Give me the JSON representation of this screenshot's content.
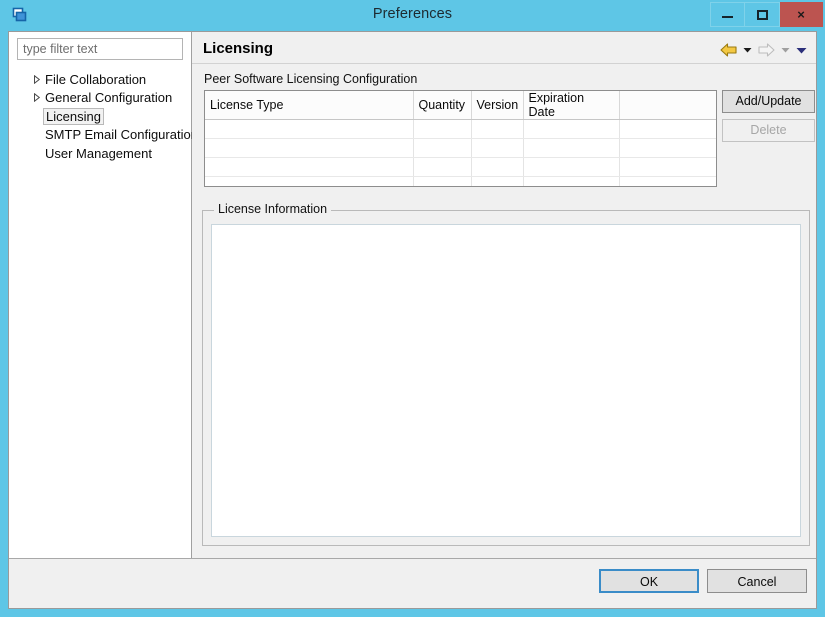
{
  "window": {
    "title": "Preferences",
    "icon": "preferences-window-icon",
    "titlebar_color": "#5ec6e6",
    "close_button_color": "#bc5450",
    "controls": {
      "minimize": "minimize-icon",
      "maximize": "maximize-icon",
      "close": "×"
    }
  },
  "sidebar": {
    "filter": {
      "value": "",
      "placeholder": "type filter text"
    },
    "tree": [
      {
        "label": "File Collaboration",
        "expandable": true,
        "selected": false
      },
      {
        "label": "General Configuration",
        "expandable": true,
        "selected": false
      },
      {
        "label": "Licensing",
        "expandable": false,
        "selected": true
      },
      {
        "label": "SMTP Email Configuration",
        "expandable": false,
        "selected": false
      },
      {
        "label": "User Management",
        "expandable": false,
        "selected": false
      }
    ]
  },
  "main": {
    "page_title": "Licensing",
    "section_label": "Peer Software Licensing Configuration",
    "toolbar": {
      "back": "back-arrow-icon",
      "back_menu": "back-dropdown-icon",
      "forward": "forward-arrow-icon",
      "forward_menu": "forward-dropdown-icon",
      "view_menu": "view-menu-icon",
      "back_color": "#e0a80e",
      "forward_color": "#bdbdbd",
      "menu_color": "#2b2f7a"
    },
    "table": {
      "columns": [
        "License Type",
        "Quantity",
        "Version",
        "Expiration Date",
        ""
      ],
      "rows": [
        [
          "",
          "",
          "",
          "",
          ""
        ],
        [
          "",
          "",
          "",
          "",
          ""
        ],
        [
          "",
          "",
          "",
          "",
          ""
        ],
        [
          "",
          "",
          "",
          "",
          ""
        ]
      ]
    },
    "buttons": {
      "add_update": {
        "label": "Add/Update",
        "enabled": true
      },
      "delete": {
        "label": "Delete",
        "enabled": false
      }
    },
    "group": {
      "title": "License Information",
      "content": ""
    }
  },
  "footer": {
    "ok": "OK",
    "cancel": "Cancel"
  }
}
